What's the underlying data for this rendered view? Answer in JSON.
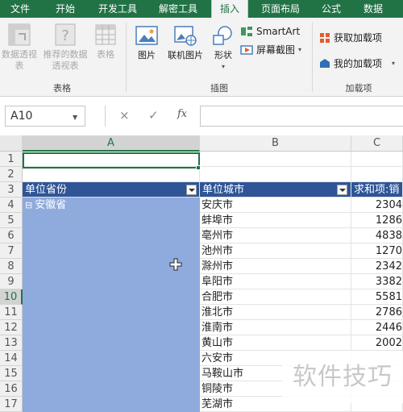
{
  "tabs": [
    "文件",
    "开始",
    "开发工具",
    "解密工具",
    "插入",
    "页面布局",
    "公式",
    "数据"
  ],
  "active_tab": "插入",
  "ribbon": {
    "tables_group": {
      "label": "表格",
      "pivot_table": "数据透视表",
      "recommended_pivot": "推荐的数据透视表",
      "table": "表格"
    },
    "illustrations_group": {
      "label": "插图",
      "pictures": "图片",
      "online_pictures": "联机图片",
      "shapes": "形状",
      "smartart": "SmartArt",
      "screenshot": "屏幕截图"
    },
    "addins_group": {
      "label": "加载项",
      "get_addins": "获取加载项",
      "my_addins": "我的加载项"
    }
  },
  "formula_bar": {
    "name_box": "A10",
    "cancel_icon": "×",
    "enter_icon": "✓",
    "fx": "fx",
    "value": ""
  },
  "grid": {
    "columns": [
      "A",
      "B",
      "C"
    ],
    "rows": [
      "1",
      "2",
      "3",
      "4",
      "5",
      "6",
      "7",
      "8",
      "9",
      "10",
      "11",
      "12",
      "13",
      "14",
      "15",
      "16",
      "17"
    ],
    "selected_cell": "A10",
    "header_row": {
      "col_a": "单位省份",
      "col_b": "单位城市",
      "col_c": "求和项:销"
    },
    "province": "安徽省",
    "collapse_symbol": "⊟",
    "cities": [
      "安庆市",
      "蚌埠市",
      "亳州市",
      "池州市",
      "滁州市",
      "阜阳市",
      "合肥市",
      "淮北市",
      "淮南市",
      "黄山市",
      "六安市",
      "马鞍山市",
      "铜陵市",
      "芜湖市"
    ],
    "values": [
      "2304",
      "1286",
      "4838",
      "1270",
      "2342",
      "3382",
      "5581",
      "2786",
      "2446",
      "2002",
      "",
      "",
      "",
      ""
    ]
  },
  "watermark": "软件技巧",
  "colors": {
    "tab_bar": "#217346",
    "pivot_header": "#2f5597",
    "pivot_fill": "#8faadc",
    "selection": "#217346"
  }
}
